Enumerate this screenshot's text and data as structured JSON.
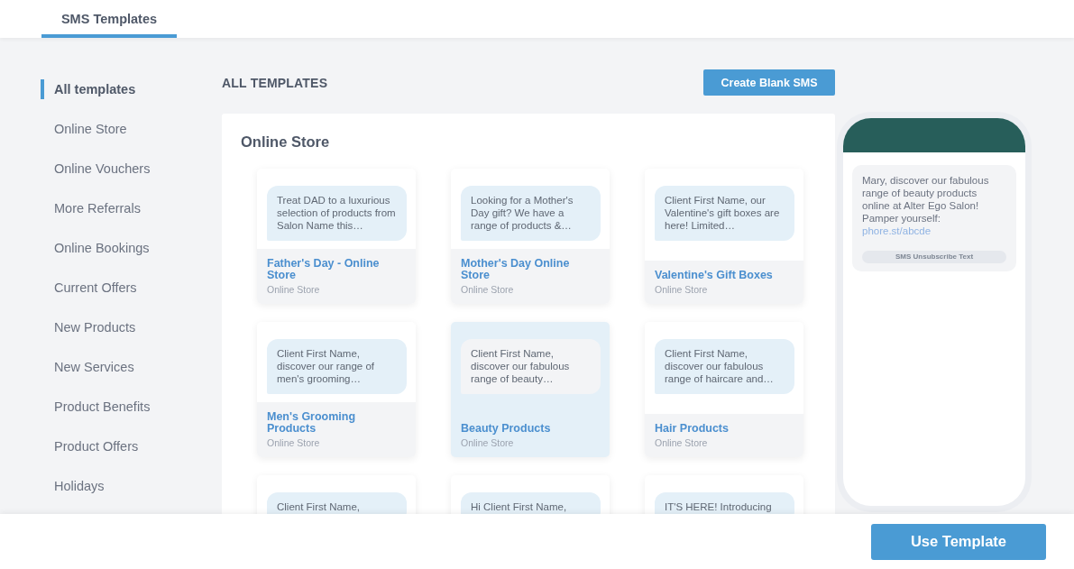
{
  "tabs": [
    {
      "label": "SMS Templates",
      "selected": true
    }
  ],
  "sidebar": {
    "items": [
      {
        "label": "All templates",
        "selected": true
      },
      {
        "label": "Online Store",
        "selected": false
      },
      {
        "label": "Online Vouchers",
        "selected": false
      },
      {
        "label": "More Referrals",
        "selected": false
      },
      {
        "label": "Online Bookings",
        "selected": false
      },
      {
        "label": "Current Offers",
        "selected": false
      },
      {
        "label": "New Products",
        "selected": false
      },
      {
        "label": "New Services",
        "selected": false
      },
      {
        "label": "Product Benefits",
        "selected": false
      },
      {
        "label": "Product Offers",
        "selected": false
      },
      {
        "label": "Holidays",
        "selected": false
      }
    ]
  },
  "main": {
    "heading": "ALL TEMPLATES",
    "create_button": "Create Blank SMS"
  },
  "section": {
    "title": "Online Store",
    "templates": [
      {
        "message": "Treat DAD to a luxurious selection of products from Salon Name this…",
        "title": "Father's Day - Online Store",
        "category": "Online Store",
        "selected": false
      },
      {
        "message": "Looking for a Mother's Day gift? We have a range of products &…",
        "title": "Mother's Day Online Store",
        "category": "Online Store",
        "selected": false
      },
      {
        "message": "Client First Name, our Valentine's gift boxes are here! Limited…",
        "title": "Valentine's Gift Boxes",
        "category": "Online Store",
        "selected": false
      },
      {
        "message": "Client First Name, discover our range of men's grooming…",
        "title": "Men's Grooming Products",
        "category": "Online Store",
        "selected": false
      },
      {
        "message": "Client First Name, discover our fabulous range of beauty…",
        "title": "Beauty Products",
        "category": "Online Store",
        "selected": true
      },
      {
        "message": "Client First Name, discover our fabulous range of haircare and…",
        "title": "Hair Products",
        "category": "Online Store",
        "selected": false
      },
      {
        "message": "Client First Name,",
        "selected": false
      },
      {
        "message": "Hi Client First Name,",
        "selected": false
      },
      {
        "message": "IT'S HERE! Introducing",
        "selected": false
      }
    ]
  },
  "preview": {
    "message": "Mary, discover our fabulous range of beauty products online at Alter Ego Salon! Pamper yourself:",
    "link": "phore.st/abcde",
    "unsubscribe": "SMS Unsubscribe Text"
  },
  "footer": {
    "use_button": "Use Template"
  }
}
